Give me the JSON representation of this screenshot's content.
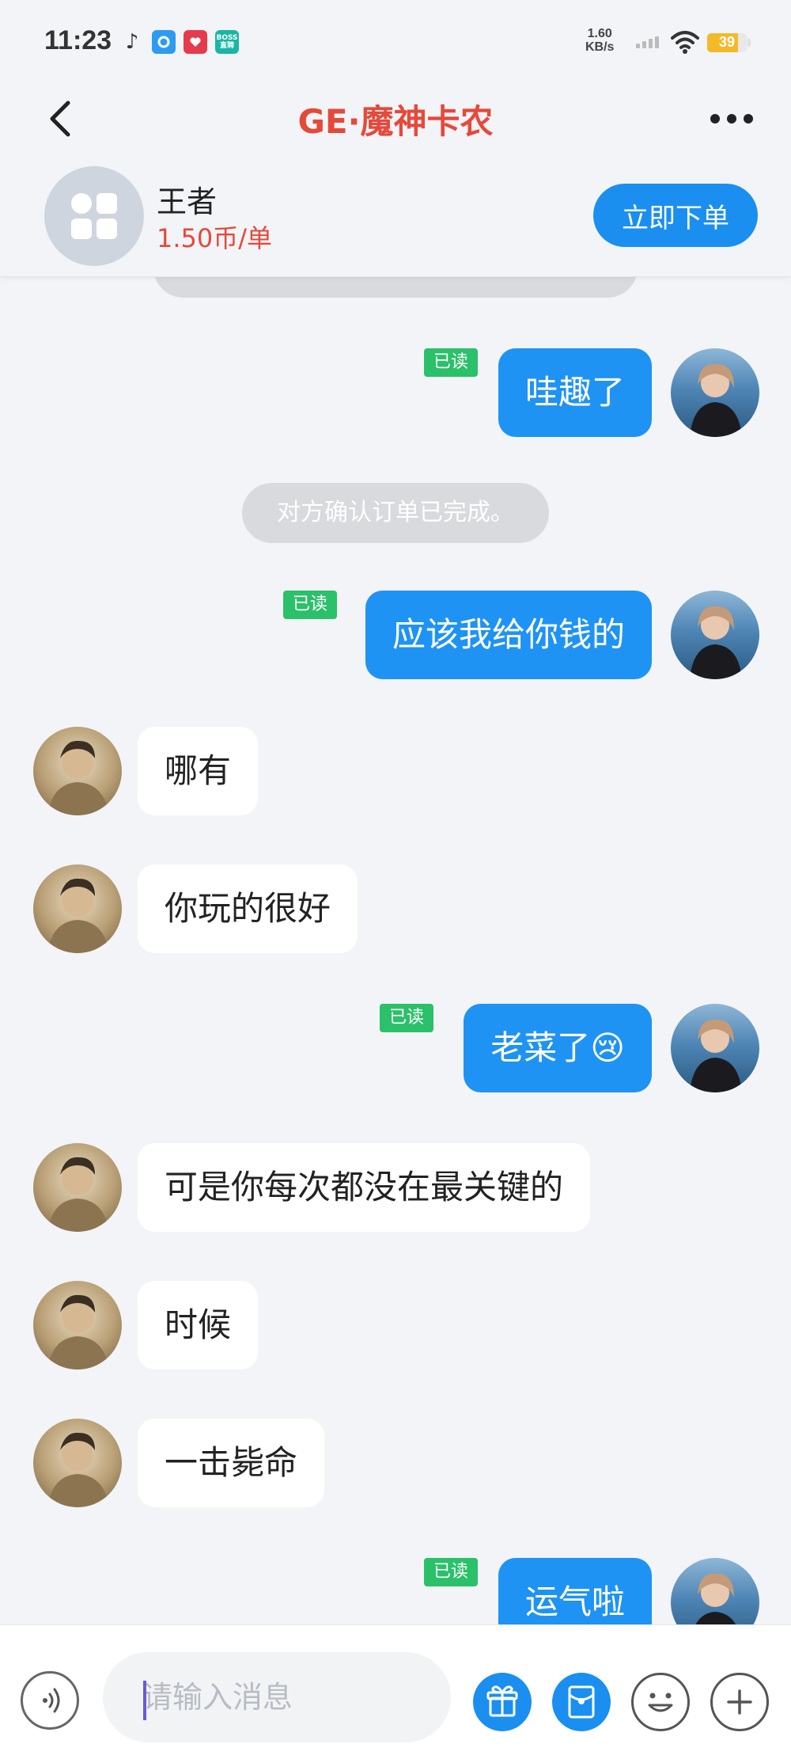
{
  "status_bar": {
    "time": "11:23",
    "net_speed_value": "1.60",
    "net_speed_unit": "KB/s",
    "battery": "39",
    "apps": [
      {
        "icon": "tiktok-icon"
      },
      {
        "icon": "blue-app-icon"
      },
      {
        "icon": "red-app-icon"
      },
      {
        "icon": "boss-icon",
        "label": "BOSS\n直聘"
      }
    ]
  },
  "nav": {
    "title": "GE·魔神卡农"
  },
  "service": {
    "name": "王者",
    "price": "1.50币/单",
    "order_label": "立即下单"
  },
  "chat": {
    "read_label": "已读",
    "messages": [
      {
        "from": "me",
        "text": "哇趣了",
        "read": true
      },
      {
        "from": "system",
        "text": "对方确认订单已完成。"
      },
      {
        "from": "me",
        "text": "应该我给你钱的",
        "read": true
      },
      {
        "from": "other",
        "text": "哪有"
      },
      {
        "from": "other",
        "text": "你玩的很好"
      },
      {
        "from": "me",
        "text": "老菜了😢",
        "read": true
      },
      {
        "from": "other",
        "text": "可是你每次都没在最关键的"
      },
      {
        "from": "other",
        "text": "时候"
      },
      {
        "from": "other",
        "text": "一击毙命"
      },
      {
        "from": "me",
        "text": "运气啦",
        "read": true
      }
    ]
  },
  "input": {
    "placeholder": "请输入消息",
    "value": ""
  },
  "colors": {
    "accent": "#1f93f3",
    "title_red": "#e5493a",
    "read_green": "#2bc06a"
  }
}
